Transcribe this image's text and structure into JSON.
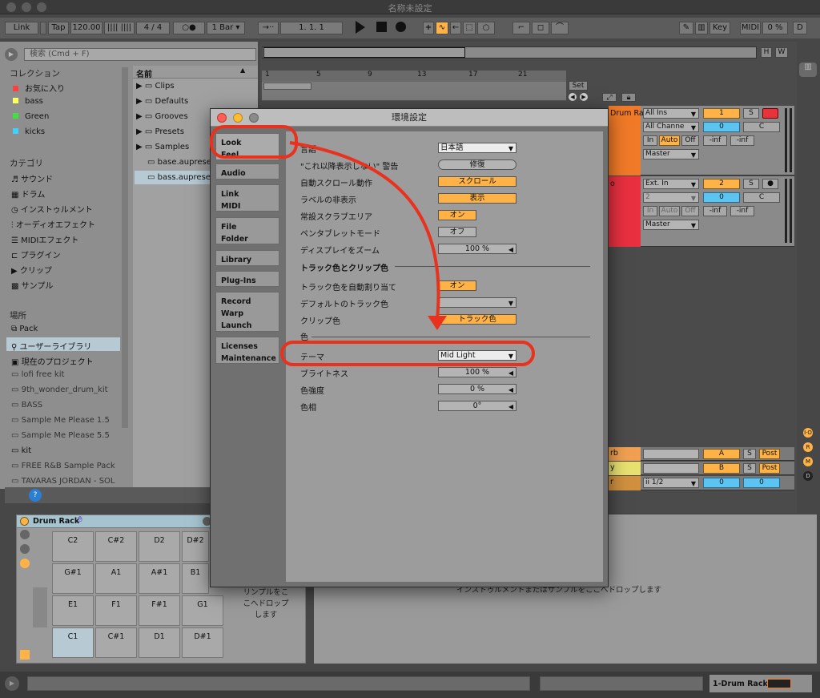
{
  "window": {
    "title": "名称未設定"
  },
  "toolbar": {
    "link": "Link",
    "tap": "Tap",
    "tempo": "120.00",
    "nudge": "|||| ||||",
    "sig_num": "4",
    "sig_den": "4",
    "metro": "○●",
    "quant": "1 Bar",
    "follow": "→··",
    "position": "1.   1.   1",
    "key": "Key",
    "midi": "MIDI",
    "cpu": "0 %",
    "disk": "D"
  },
  "arrangement": {
    "ruler": [
      "1",
      "5",
      "9",
      "13",
      "17",
      "21"
    ],
    "set_label": "Set",
    "overview_h": "H",
    "overview_w": "W"
  },
  "tracks": [
    {
      "name": "Drum Rack",
      "input": "All Ins",
      "channel": "All Channe",
      "monitor": [
        "In",
        "Auto",
        "Off"
      ],
      "output": "Master",
      "number": "1",
      "vol": "0",
      "pan": "C",
      "solo": "S",
      "inf1": "-inf",
      "inf2": "-inf"
    },
    {
      "name": "o",
      "input": "Ext. In",
      "channel": "2",
      "monitor": [
        "In",
        "Auto",
        "Off"
      ],
      "output": "Master",
      "number": "2",
      "vol": "0",
      "pan": "C",
      "solo": "S",
      "inf1": "-inf",
      "inf2": "-inf"
    }
  ],
  "returns": [
    {
      "name": "rb",
      "letter": "A",
      "solo": "S",
      "post": "Post"
    },
    {
      "name": "y",
      "letter": "B",
      "solo": "S",
      "post": "Post"
    },
    {
      "name": "r",
      "channel": "ii 1/2",
      "vol": "0",
      "pan": "0"
    }
  ],
  "browser": {
    "search_placeholder": "検索 (Cmd + F)",
    "collections_header": "コレクション",
    "collections": [
      {
        "label": "お気に入り",
        "color": "#ff4040"
      },
      {
        "label": "bass",
        "color": "#ffff60"
      },
      {
        "label": "Green",
        "color": "#40e040"
      },
      {
        "label": "kicks",
        "color": "#40d0ff"
      }
    ],
    "categories_header": "カテゴリ",
    "categories": [
      "サウンド",
      "ドラム",
      "インストゥルメント",
      "オーディオエフェクト",
      "MIDIエフェクト",
      "プラグイン",
      "クリップ",
      "サンプル"
    ],
    "places_header": "場所",
    "places": [
      "Pack",
      "ユーザーライブラリ",
      "現在のプロジェクト",
      "lofi free kit",
      "9th_wonder_drum_kit",
      "BASS",
      "Sample Me Please 1.5",
      "Sample Me Please 5.5",
      "kit",
      "FREE R&B Sample Pack",
      "TAVARAS JORDAN - SOL"
    ],
    "list_header": "名前",
    "folders": [
      "Clips",
      "Defaults",
      "Grooves",
      "Presets",
      "Samples"
    ],
    "files": [
      "base.aupreset",
      "bass.aupreset"
    ]
  },
  "device": {
    "name": "Drum Rack",
    "pads": [
      [
        "C2",
        "C#2",
        "D2",
        "D#2"
      ],
      [
        "G#1",
        "A1",
        "A#1",
        "B1"
      ],
      [
        "E1",
        "F1",
        "F#1",
        "G1"
      ],
      [
        "C1",
        "C#1",
        "D1",
        "D#1"
      ]
    ],
    "drop_small": [
      "リンプルをこ",
      "こへドロップ",
      "します"
    ],
    "drop_main": "インストゥルメントまたはサンプルをここへドロップします"
  },
  "bottom": {
    "track_label": "1-Drum Rack"
  },
  "preferences": {
    "title": "環境設定",
    "tabs": [
      {
        "lines": [
          "Look",
          "Feel"
        ]
      },
      {
        "lines": [
          "Audio"
        ]
      },
      {
        "lines": [
          "Link",
          "MIDI"
        ]
      },
      {
        "lines": [
          "File",
          "Folder"
        ]
      },
      {
        "lines": [
          "Library"
        ]
      },
      {
        "lines": [
          "Plug-Ins"
        ]
      },
      {
        "lines": [
          "Record",
          "Warp",
          "Launch"
        ]
      },
      {
        "lines": [
          "Licenses",
          "Maintenance"
        ]
      }
    ],
    "rows1": [
      {
        "label": "言語",
        "value": "日本語",
        "kind": "w"
      },
      {
        "label": "\"これ以降表示しない\" 警告",
        "value": "修復",
        "kind": "r"
      },
      {
        "label": "自動スクロール動作",
        "value": "スクロール",
        "kind": "o"
      },
      {
        "label": "ラベルの非表示",
        "value": "表示",
        "kind": "o"
      },
      {
        "label": "常設スクラブエリア",
        "value": "オン",
        "kind": "os"
      },
      {
        "label": "ペンタブレットモード",
        "value": "オフ",
        "kind": "gs"
      },
      {
        "label": "ディスプレイをズーム",
        "value": "100 %",
        "kind": "g"
      }
    ],
    "section2": "トラック色とクリップ色",
    "rows2": [
      {
        "label": "トラック色を自動割り当て",
        "value": "オン",
        "kind": "os"
      },
      {
        "label": "デフォルトのトラック色",
        "value": "",
        "kind": "l"
      },
      {
        "label": "クリップ色",
        "value": "トラック色",
        "kind": "o"
      }
    ],
    "section3": "色",
    "rows3": [
      {
        "label": "テーマ",
        "value": "Mid Light",
        "kind": "w"
      },
      {
        "label": "ブライトネス",
        "value": "100 %",
        "kind": "g"
      },
      {
        "label": "色強度",
        "value": "0 %",
        "kind": "g"
      },
      {
        "label": "色相",
        "value": "0°",
        "kind": "g"
      }
    ]
  },
  "annotation": {
    "color": "#e8321e"
  }
}
